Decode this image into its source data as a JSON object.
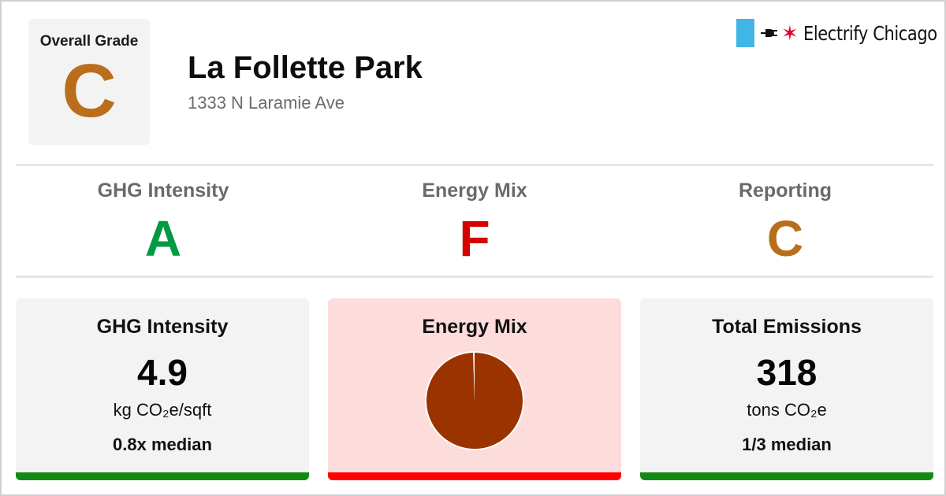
{
  "header": {
    "overall_label": "Overall Grade",
    "overall_grade": "C",
    "overall_color": "#b86e1a",
    "title": "La Follette Park",
    "address": "1333 N Laramie Ave"
  },
  "brand": {
    "name": "Electrify Chicago",
    "icons": [
      "flag-bar-icon",
      "plug-icon",
      "star-icon"
    ],
    "flag_color": "#41b6e6",
    "star_color": "#e4002b"
  },
  "grades": [
    {
      "label": "GHG Intensity",
      "grade": "A",
      "color": "#009a44"
    },
    {
      "label": "Energy Mix",
      "grade": "F",
      "color": "#d50000"
    },
    {
      "label": "Reporting",
      "grade": "C",
      "color": "#b86e1a"
    }
  ],
  "cards": {
    "ghg": {
      "title": "GHG Intensity",
      "value": "4.9",
      "unit": "kg CO₂e/sqft",
      "median": "0.8x median",
      "bg": "#f3f3f3",
      "bar_color": "#138a13"
    },
    "energy": {
      "title": "Energy Mix",
      "bg": "#fddcdc",
      "bar_color": "#ff0000"
    },
    "emissions": {
      "title": "Total Emissions",
      "value": "318",
      "unit": "tons CO₂e",
      "median": "1/3 median",
      "bg": "#f3f3f3",
      "bar_color": "#138a13"
    }
  },
  "chart_data": {
    "type": "pie",
    "slices": [
      {
        "share": 0.995,
        "color": "#9b3300"
      },
      {
        "share": 0.005,
        "color": "#ffffff"
      }
    ]
  }
}
